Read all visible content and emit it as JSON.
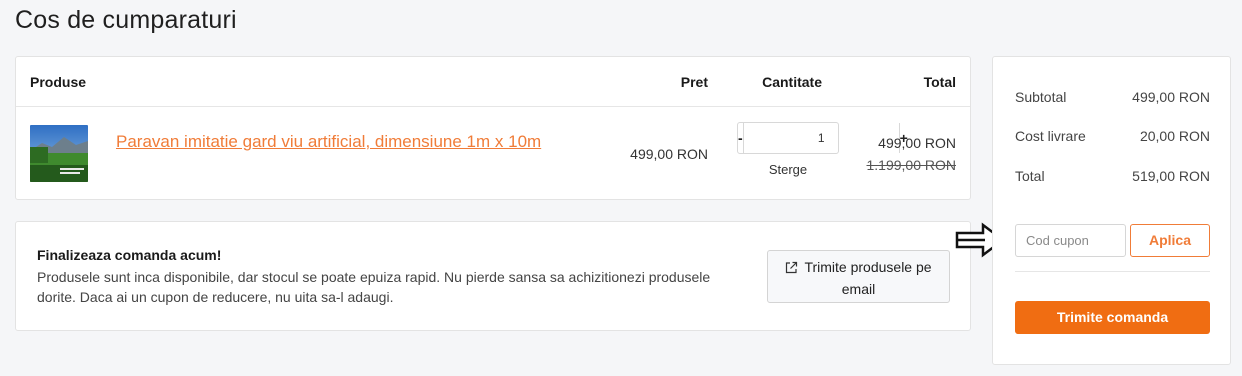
{
  "page": {
    "title": "Cos de cumparaturi"
  },
  "cart": {
    "headers": {
      "product": "Produse",
      "price": "Pret",
      "quantity": "Cantitate",
      "total": "Total"
    },
    "items": [
      {
        "name": "Paravan imitatie gard viu artificial, dimensiune 1m x 10m",
        "price": "499,00 RON",
        "quantity": "1",
        "remove_label": "Sterge",
        "total": "499,00 RON",
        "old_total": "1.199,00 RON"
      }
    ],
    "qty_minus": "-",
    "qty_plus": "+"
  },
  "promo": {
    "title": "Finalizeaza comanda acum!",
    "text": "Produsele sunt inca disponibile, dar stocul se poate epuiza rapid. Nu pierde sansa sa achizitionezi produsele dorite. Daca ai un cupon de reducere, nu uita sa-l adaugi.",
    "email_button": "Trimite produsele pe email",
    "email_icon": "share-icon"
  },
  "summary": {
    "subtotal_label": "Subtotal",
    "subtotal_value": "499,00 RON",
    "shipping_label": "Cost livrare",
    "shipping_value": "20,00 RON",
    "total_label": "Total",
    "total_value": "519,00 RON",
    "coupon_placeholder": "Cod cupon",
    "apply_label": "Aplica",
    "submit_label": "Trimite comanda"
  },
  "colors": {
    "accent": "#f07c38",
    "submit_bg": "#f06d12"
  }
}
